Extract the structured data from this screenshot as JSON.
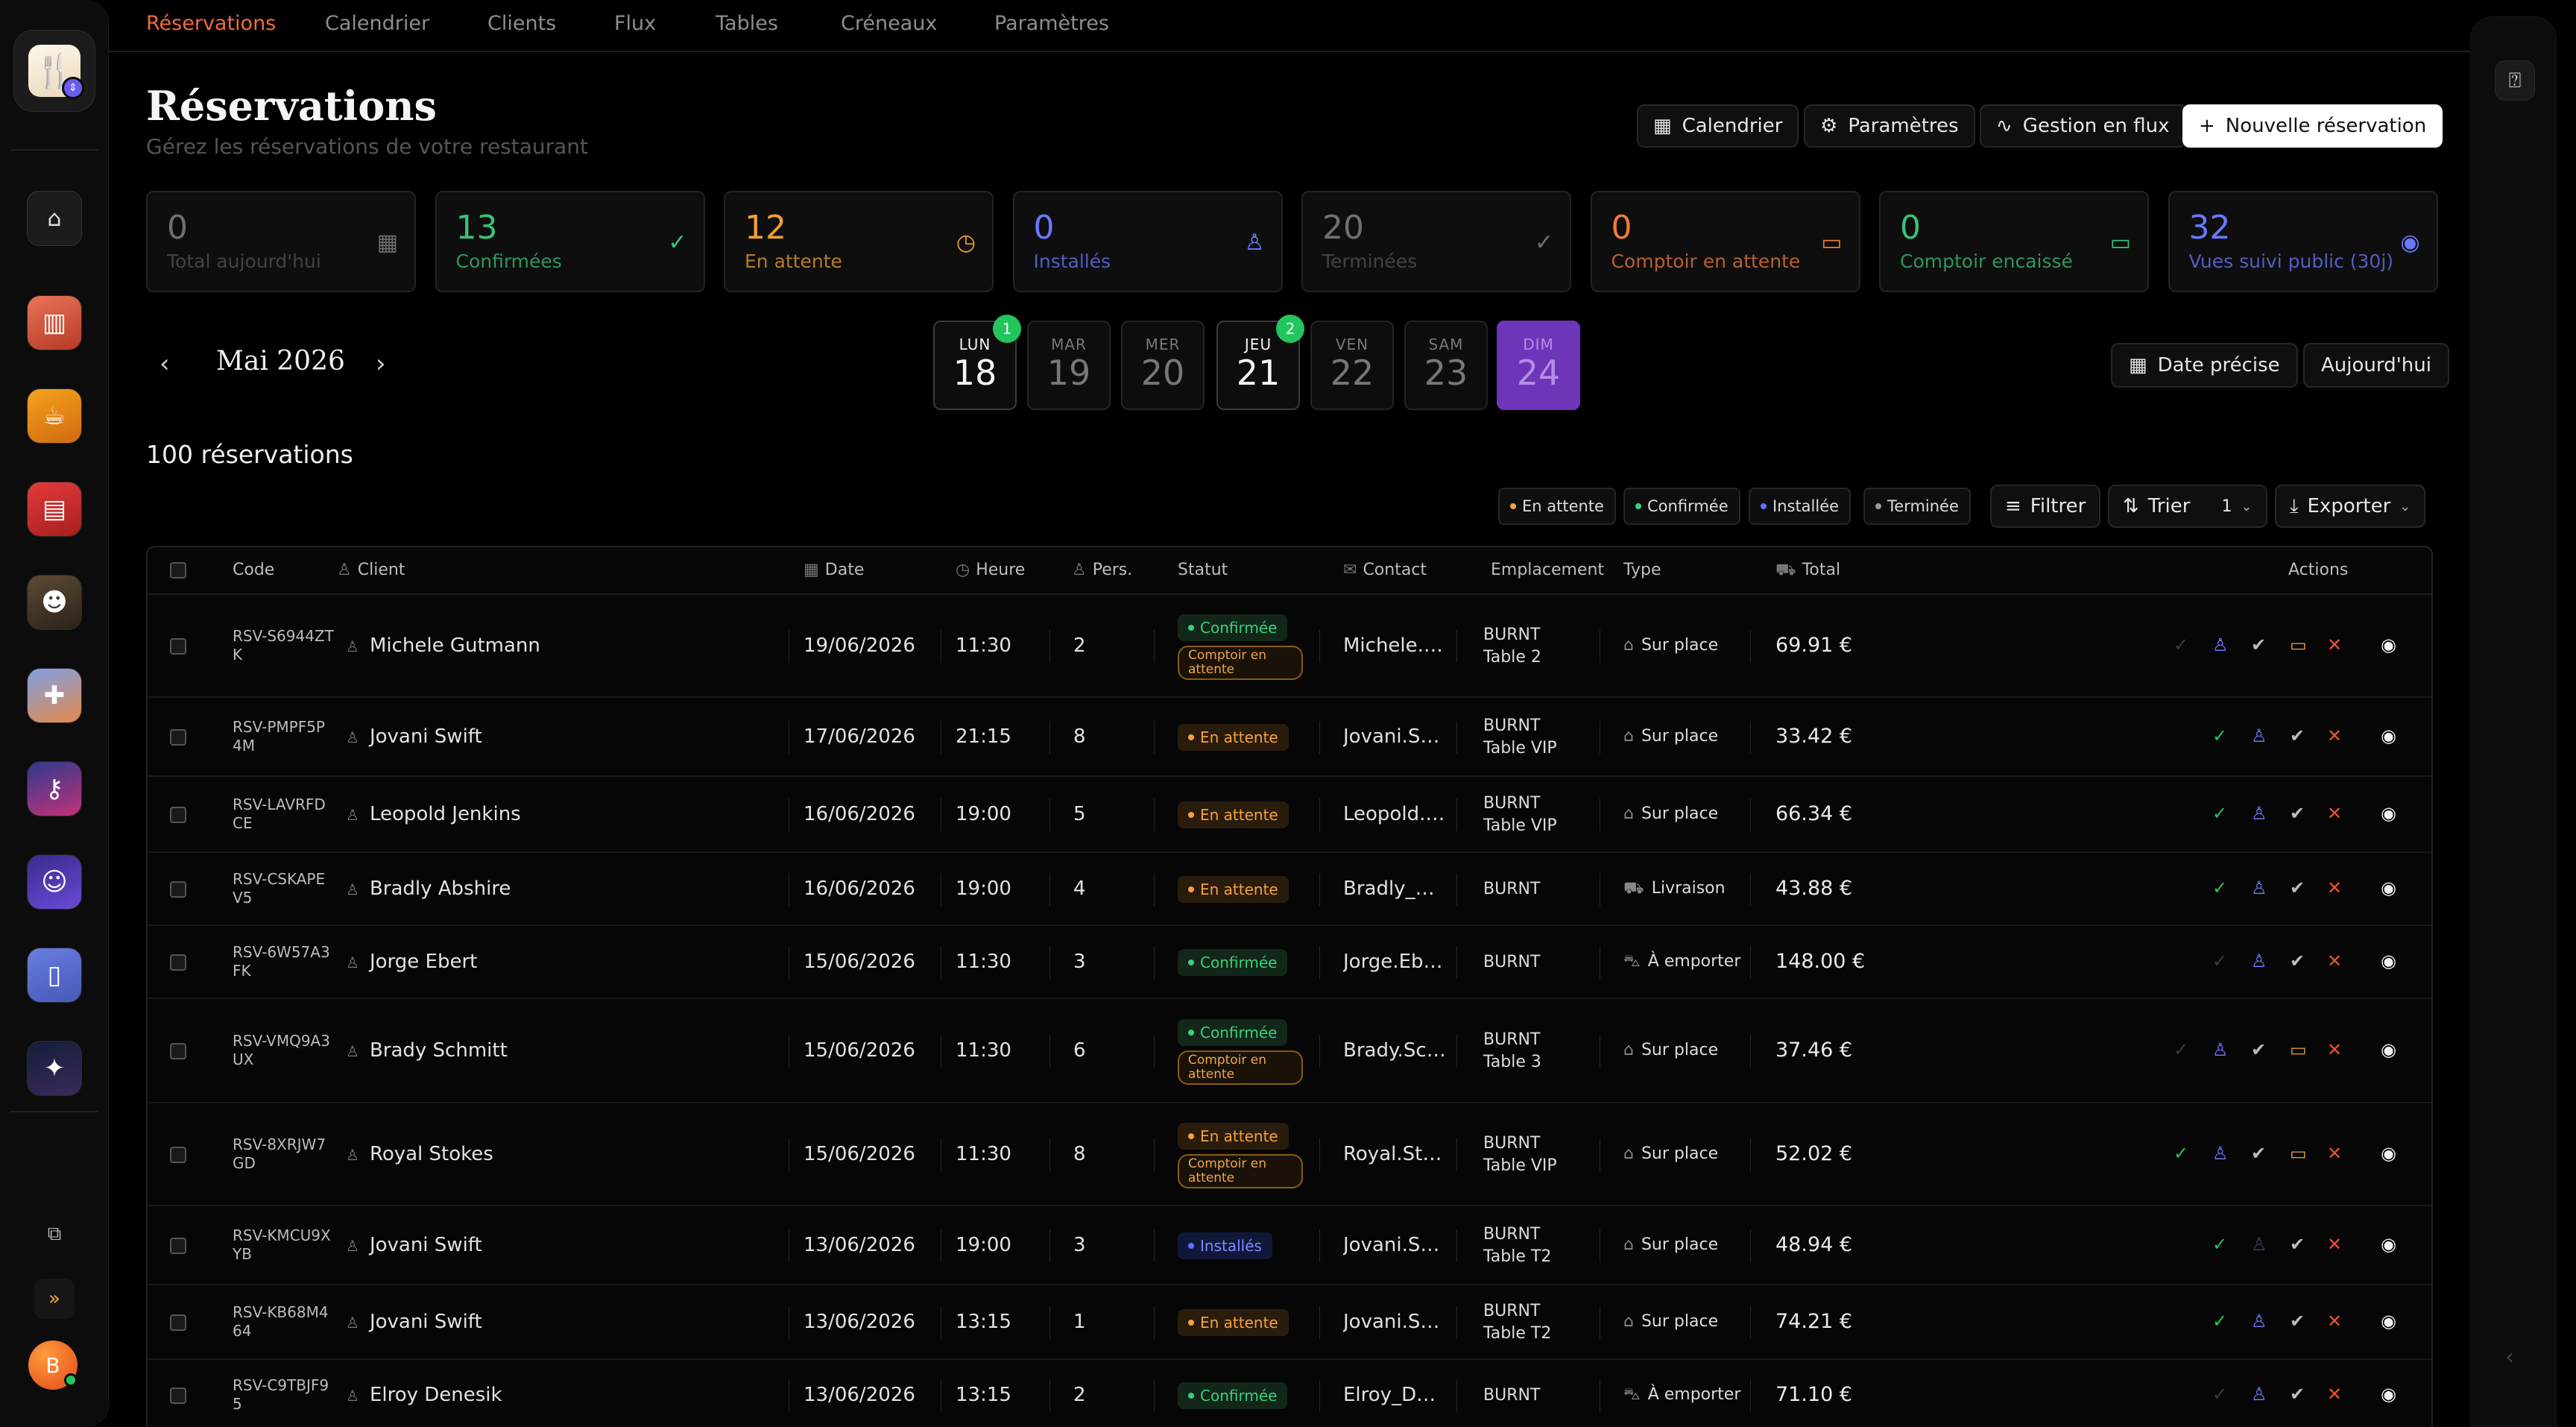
{
  "nav": {
    "items": [
      "Réservations",
      "Calendrier",
      "Clients",
      "Flux",
      "Tables",
      "Créneaux",
      "Paramètres"
    ],
    "active": 0
  },
  "header": {
    "title": "Réservations",
    "subtitle": "Gérez les réservations de votre restaurant",
    "buttons": {
      "calendar": "Calendrier",
      "settings": "Paramètres",
      "flux": "Gestion en flux",
      "new": "Nouvelle réservation"
    }
  },
  "stats": [
    {
      "value": "0",
      "label": "Total aujourd'hui",
      "icon": "calendar-icon",
      "color": "#6f6f6f"
    },
    {
      "value": "13",
      "label": "Confirmées",
      "icon": "check-icon",
      "color": "#37c27a"
    },
    {
      "value": "12",
      "label": "En attente",
      "icon": "clock-icon",
      "color": "#f0a030"
    },
    {
      "value": "0",
      "label": "Installés",
      "icon": "users-icon",
      "color": "#6c77ff"
    },
    {
      "value": "20",
      "label": "Terminées",
      "icon": "check-icon",
      "color": "#6f6f6f"
    },
    {
      "value": "0",
      "label": "Comptoir en attente",
      "icon": "card-icon",
      "color": "#f07a3a"
    },
    {
      "value": "0",
      "label": "Comptoir encaissé",
      "icon": "card-icon",
      "color": "#37c27a"
    },
    {
      "value": "32",
      "label": "Vues suivi public (30j)",
      "icon": "eye-icon",
      "color": "#6c77ff"
    }
  ],
  "dates": {
    "month": "Mai 2026",
    "days": [
      {
        "name": "LUN",
        "num": "18",
        "badge": "1",
        "style": "strong"
      },
      {
        "name": "MAR",
        "num": "19",
        "badge": "",
        "style": ""
      },
      {
        "name": "MER",
        "num": "20",
        "badge": "",
        "style": ""
      },
      {
        "name": "JEU",
        "num": "21",
        "badge": "2",
        "style": "strong"
      },
      {
        "name": "VEN",
        "num": "22",
        "badge": "",
        "style": ""
      },
      {
        "name": "SAM",
        "num": "23",
        "badge": "",
        "style": ""
      },
      {
        "name": "DIM",
        "num": "24",
        "badge": "",
        "style": "selected"
      }
    ],
    "precise": "Date précise",
    "today": "Aujourd'hui"
  },
  "count": "100 réservations",
  "filters": {
    "chips": [
      {
        "label": "En attente",
        "color": "#f6a13c"
      },
      {
        "label": "Confirmée",
        "color": "#3ad07a"
      },
      {
        "label": "Installée",
        "color": "#6070ff"
      },
      {
        "label": "Terminée",
        "color": "#9a9a9a"
      }
    ],
    "filter": "Filtrer",
    "sort": "Trier",
    "sort_count": "1",
    "export": "Exporter"
  },
  "table": {
    "headers": {
      "code": "Code",
      "client": "Client",
      "date": "Date",
      "time": "Heure",
      "pers": "Pers.",
      "status": "Statut",
      "contact": "Contact",
      "location": "Emplacement",
      "type": "Type",
      "total": "Total",
      "actions": "Actions"
    },
    "rows": [
      {
        "code": "RSV-S6944ZTK",
        "client": "Michele Gutmann",
        "date": "19/06/2026",
        "time": "11:30",
        "pers": "2",
        "status": "Confirmée",
        "kind": "ok",
        "counter": "Comptoir en attente",
        "contact": "Michele.Gutmann",
        "loc1": "BURNT",
        "loc2": "Table 2",
        "type": "Sur place",
        "type_icon": "home-icon",
        "total": "69.91 €",
        "pay": true
      },
      {
        "code": "RSV-PMPF5P4M",
        "client": "Jovani Swift",
        "date": "17/06/2026",
        "time": "21:15",
        "pers": "8",
        "status": "En attente",
        "kind": "wait",
        "counter": "",
        "contact": "Jovani.Swift",
        "loc1": "BURNT",
        "loc2": "Table VIP",
        "type": "Sur place",
        "type_icon": "home-icon",
        "total": "33.42 €",
        "pay": false
      },
      {
        "code": "RSV-LAVRFDCE",
        "client": "Leopold Jenkins",
        "date": "16/06/2026",
        "time": "19:00",
        "pers": "5",
        "status": "En attente",
        "kind": "wait",
        "counter": "",
        "contact": "Leopold.Jenkins",
        "loc1": "BURNT",
        "loc2": "Table VIP",
        "type": "Sur place",
        "type_icon": "home-icon",
        "total": "66.34 €",
        "pay": false
      },
      {
        "code": "RSV-CSKAPEV5",
        "client": "Bradly Abshire",
        "date": "16/06/2026",
        "time": "19:00",
        "pers": "4",
        "status": "En attente",
        "kind": "wait",
        "counter": "",
        "contact": "Bradly_Abshire",
        "loc1": "BURNT",
        "loc2": "",
        "type": "Livraison",
        "type_icon": "truck-icon",
        "total": "43.88 €",
        "pay": false
      },
      {
        "code": "RSV-6W57A3FK",
        "client": "Jorge Ebert",
        "date": "15/06/2026",
        "time": "11:30",
        "pers": "3",
        "status": "Confirmée",
        "kind": "ok",
        "counter": "",
        "contact": "Jorge.Ebert",
        "loc1": "BURNT",
        "loc2": "",
        "type": "À emporter",
        "type_icon": "car-icon",
        "total": "148.00 €",
        "pay": false
      },
      {
        "code": "RSV-VMQ9A3UX",
        "client": "Brady Schmitt",
        "date": "15/06/2026",
        "time": "11:30",
        "pers": "6",
        "status": "Confirmée",
        "kind": "ok",
        "counter": "Comptoir en attente",
        "contact": "Brady.Schmitt",
        "loc1": "BURNT",
        "loc2": "Table 3",
        "type": "Sur place",
        "type_icon": "home-icon",
        "total": "37.46 €",
        "pay": true
      },
      {
        "code": "RSV-8XRJW7GD",
        "client": "Royal Stokes",
        "date": "15/06/2026",
        "time": "11:30",
        "pers": "8",
        "status": "En attente",
        "kind": "wait",
        "counter": "Comptoir en attente",
        "contact": "Royal.Stokes",
        "loc1": "BURNT",
        "loc2": "Table VIP",
        "type": "Sur place",
        "type_icon": "home-icon",
        "total": "52.02 €",
        "pay": true
      },
      {
        "code": "RSV-KMCU9XYB",
        "client": "Jovani Swift",
        "date": "13/06/2026",
        "time": "19:00",
        "pers": "3",
        "status": "Installés",
        "kind": "inst",
        "counter": "",
        "contact": "Jovani.Swift",
        "loc1": "BURNT",
        "loc2": "Table T2",
        "type": "Sur place",
        "type_icon": "home-icon",
        "total": "48.94 €",
        "pay": false
      },
      {
        "code": "RSV-KB68M464",
        "client": "Jovani Swift",
        "date": "13/06/2026",
        "time": "13:15",
        "pers": "1",
        "status": "En attente",
        "kind": "wait",
        "counter": "",
        "contact": "Jovani.Swift",
        "loc1": "BURNT",
        "loc2": "Table T2",
        "type": "Sur place",
        "type_icon": "home-icon",
        "total": "74.21 €",
        "pay": false
      },
      {
        "code": "RSV-C9TBJF95",
        "client": "Elroy Denesik",
        "date": "13/06/2026",
        "time": "13:15",
        "pers": "2",
        "status": "Confirmée",
        "kind": "ok",
        "counter": "",
        "contact": "Elroy_Denesik",
        "loc1": "BURNT",
        "loc2": "",
        "type": "À emporter",
        "type_icon": "car-icon",
        "total": "71.10 €",
        "pay": false
      }
    ]
  },
  "colors": {
    "accent": "#f26a3d",
    "confirm": "#3ad07a",
    "waiting": "#f6a13c",
    "seated": "#6070ff",
    "selected_day": "#6d35b8",
    "cancel": "#f0502a"
  },
  "sidebar": {
    "apps": [
      "home-icon",
      "bar-chart-app",
      "serving-app",
      "kiosk-app",
      "robot-app",
      "gamepad-app",
      "key-app",
      "user-app",
      "document-app",
      "galaxy-app"
    ],
    "avatar_initial": "B"
  }
}
